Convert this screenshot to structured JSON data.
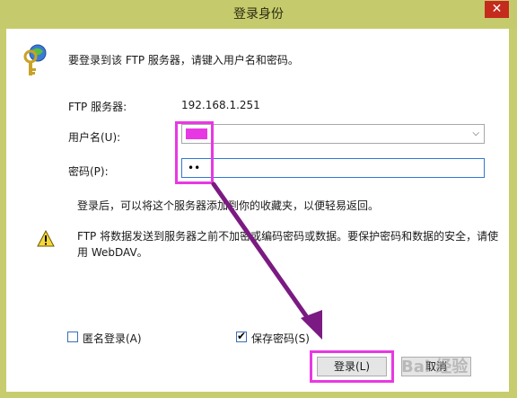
{
  "window": {
    "title": "登录身份",
    "close_label": "✕"
  },
  "intro_text": "要登录到该 FTP 服务器，请键入用户名和密码。",
  "server": {
    "label": "FTP 服务器:",
    "value": "192.168.1.251"
  },
  "username": {
    "label": "用户名(U):"
  },
  "password": {
    "label": "密码(P):",
    "value": "••"
  },
  "info_text": "登录后，可以将这个服务器添加到你的收藏夹，以便轻易返回。",
  "warning": {
    "line1": "FTP 将数据发送到服务器之前不加密或编码密码或数据。要保护密码和数据的安全，请使",
    "line2": "用 WebDAV。"
  },
  "anonymous": {
    "label": "匿名登录(A)",
    "checked": false
  },
  "save_password": {
    "label": "保存密码(S)",
    "checked": true,
    "mark": "✔"
  },
  "buttons": {
    "login": "登录(L)",
    "cancel": "取消"
  },
  "watermark": "Bai 经验",
  "colors": {
    "highlight": "#e838e3",
    "arrow": "#7b1a82",
    "titlebar": "#c5cb6c"
  }
}
